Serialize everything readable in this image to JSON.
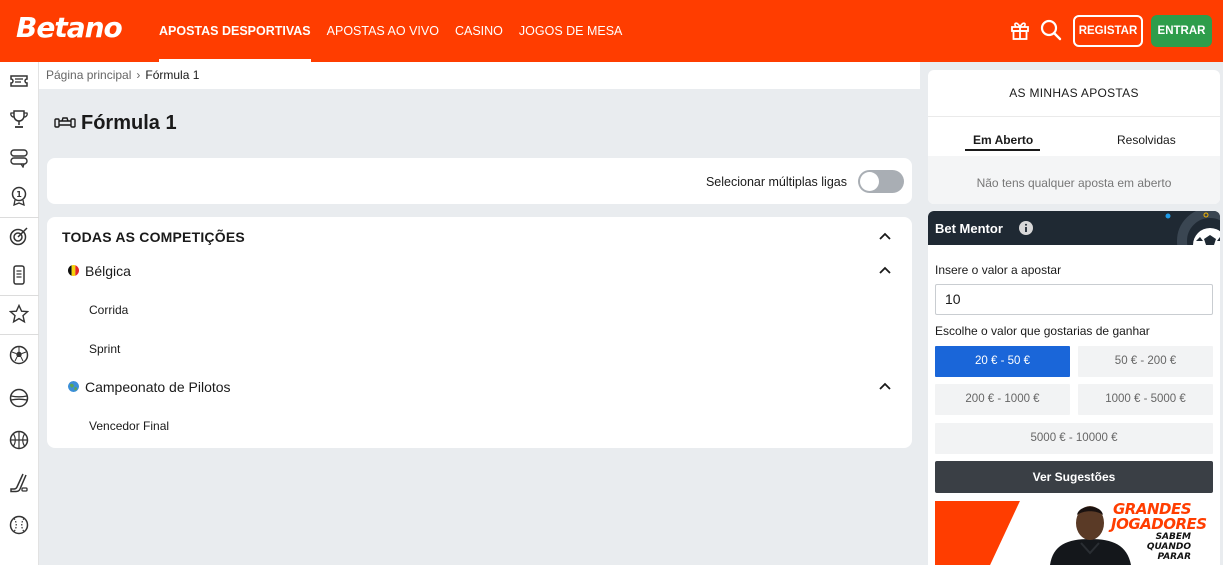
{
  "brand": {
    "name": "Betano",
    "accent": "#ff3d00",
    "green": "#2e9d4b",
    "blue": "#1a66d9"
  },
  "header": {
    "nav": [
      {
        "label": "APOSTAS DESPORTIVAS",
        "active": true
      },
      {
        "label": "APOSTAS AO VIVO"
      },
      {
        "label": "CASINO"
      },
      {
        "label": "JOGOS DE MESA"
      }
    ],
    "icons": [
      "gift-icon",
      "search-icon"
    ],
    "register_label": "REGISTAR",
    "login_label": "ENTRAR"
  },
  "rail_icons": [
    "bet-slip-icon",
    "trophy-icon",
    "chat-bets-icon",
    "badge-icon",
    "target-icon",
    "phone-icon",
    "star-icon",
    "football-icon",
    "tennis-icon",
    "basketball-icon",
    "hockey-icon",
    "baseball-icon"
  ],
  "breadcrumb": {
    "home": "Página principal",
    "current": "Fórmula 1"
  },
  "page": {
    "title": "Fórmula 1",
    "icon": "race-car-icon"
  },
  "toggle": {
    "label": "Selecionar múltiplas ligas",
    "on": false
  },
  "competitions": {
    "title": "TODAS AS COMPETIÇÕES",
    "leagues": [
      {
        "name": "Bélgica",
        "flag": "belgium-flag-icon",
        "items": [
          "Corrida",
          "Sprint"
        ]
      },
      {
        "name": "Campeonato de Pilotos",
        "flag": "world-icon",
        "items": [
          "Vencedor Final"
        ]
      }
    ]
  },
  "my_bets": {
    "title": "AS MINHAS APOSTAS",
    "tabs": [
      "Em Aberto",
      "Resolvidas"
    ],
    "active_tab": 0,
    "empty_text": "Não tens qualquer aposta em aberto"
  },
  "bet_mentor": {
    "title": "Bet Mentor",
    "stake_label": "Insere o valor a apostar",
    "stake_value": "10",
    "win_label": "Escolhe o valor que gostarias de ganhar",
    "ranges": [
      "20 € - 50 €",
      "50 € - 200 €",
      "200 € - 1000 €",
      "1000 € - 5000 €",
      "5000 € - 10000 €"
    ],
    "selected_range": 0,
    "suggest_label": "Ver Sugestões"
  },
  "promo": {
    "headline": "GRANDES JOGADORES",
    "subline": "SABEM QUANDO PARAR"
  }
}
